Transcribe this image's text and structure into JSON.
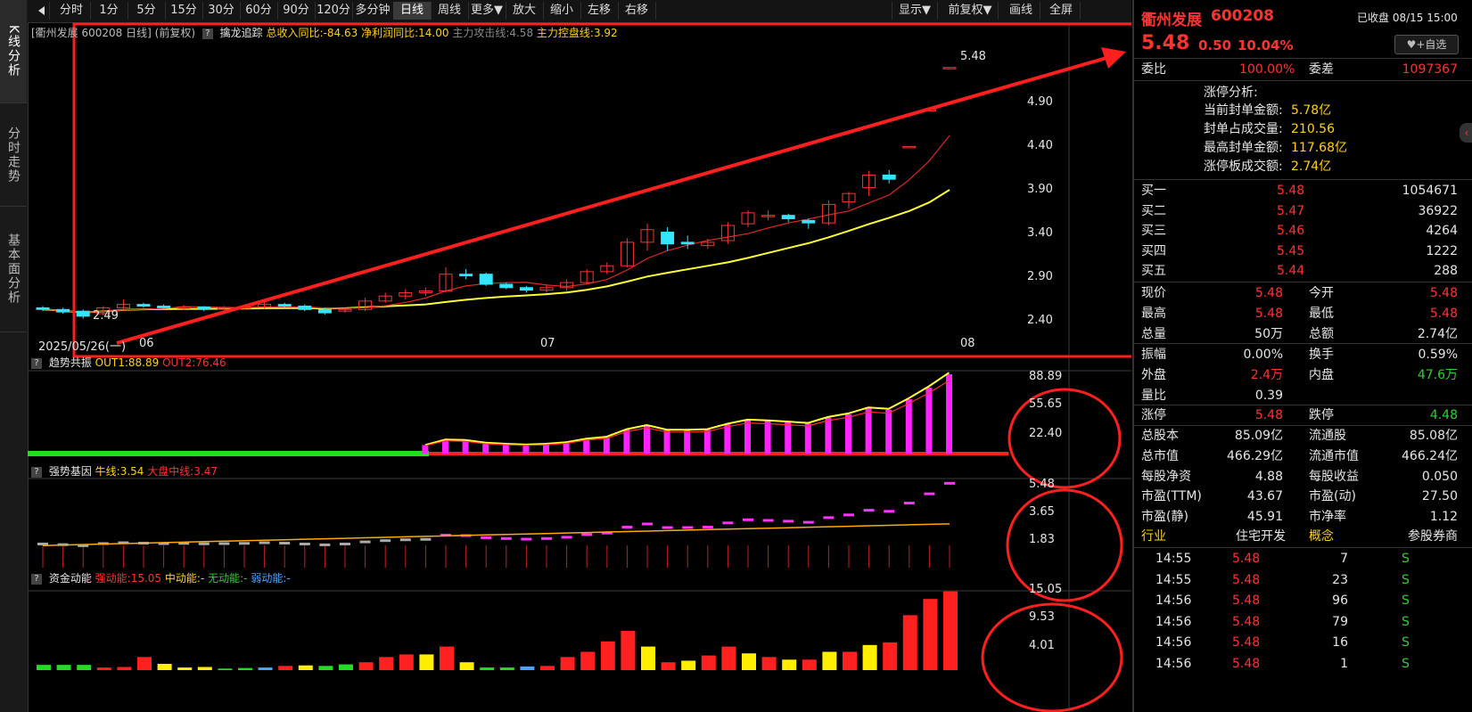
{
  "left_tabs": [
    "K线分析",
    "分时走势",
    "基本面分析"
  ],
  "toolbar": {
    "buttons": [
      "分时",
      "1分",
      "5分",
      "15分",
      "30分",
      "60分",
      "90分",
      "120分",
      "多分钟",
      "日线",
      "周线",
      "更多▼",
      "放大",
      "缩小",
      "左移",
      "右移"
    ],
    "right_buttons": [
      "显示▼",
      "前复权▼",
      "画线",
      "全屏"
    ]
  },
  "main_panel": {
    "title": "[衢州发展 600208 日线]",
    "adjust": "(前复权)",
    "indicator": "擒龙追踪",
    "rev_label": "总收入同比:-84.63",
    "profit_label": "净利润同比:14.00",
    "attack_label": "主力攻击线:4.58",
    "control_label": "主力控盘线:3.92",
    "high_label": "5.48",
    "low_label": "2.49",
    "date_label": "2025/05/26(一)",
    "months": [
      "06",
      "07",
      "08"
    ],
    "yticks": [
      "4.90",
      "4.40",
      "3.90",
      "3.40",
      "2.90",
      "2.40"
    ]
  },
  "panel2": {
    "name": "趋势共振",
    "out1": "OUT1:88.89",
    "out2": "OUT2:76.46",
    "yticks": [
      "88.89",
      "55.65",
      "22.40"
    ]
  },
  "panel3": {
    "name": "强势基因",
    "bull": "牛线:3.54",
    "mid": "大盘中线:3.47",
    "yticks": [
      "5.48",
      "3.65",
      "1.83"
    ]
  },
  "panel4": {
    "name": "资金动能",
    "strong": "强动能:15.05",
    "medium": "中动能:-",
    "none": "无动能:-",
    "weak": "弱动能:-",
    "yticks": [
      "15.05",
      "9.53",
      "4.01"
    ]
  },
  "quote": {
    "name": "衢州发展",
    "code": "600208",
    "status": "已收盘 08/15 15:00",
    "price": "5.48",
    "change": "0.50",
    "pct": "10.04%",
    "fav": "+自选",
    "webi_label": "委比",
    "webi": "100.00%",
    "wecha_label": "委差",
    "wecha": "1097367",
    "limit_title": "涨停分析:",
    "limit_rows": [
      {
        "label": "当前封单金额:",
        "value": "5.78亿"
      },
      {
        "label": "封单占成交量:",
        "value": "210.56"
      },
      {
        "label": "最高封单金额:",
        "value": "117.68亿"
      },
      {
        "label": "涨停板成交额:",
        "value": "2.74亿"
      }
    ],
    "bids": [
      {
        "label": "买一",
        "price": "5.48",
        "vol": "1054671"
      },
      {
        "label": "买二",
        "price": "5.47",
        "vol": "36922"
      },
      {
        "label": "买三",
        "price": "5.46",
        "vol": "4264"
      },
      {
        "label": "买四",
        "price": "5.45",
        "vol": "1222"
      },
      {
        "label": "买五",
        "price": "5.44",
        "vol": "288"
      }
    ],
    "stats1": [
      {
        "l1": "现价",
        "v1": "5.48",
        "c1": "red",
        "l2": "今开",
        "v2": "5.48",
        "c2": "red"
      },
      {
        "l1": "最高",
        "v1": "5.48",
        "c1": "red",
        "l2": "最低",
        "v2": "5.48",
        "c2": "red"
      },
      {
        "l1": "总量",
        "v1": "50万",
        "c1": "white",
        "l2": "总额",
        "v2": "2.74亿",
        "c2": "white"
      }
    ],
    "stats2": [
      {
        "l1": "振幅",
        "v1": "0.00%",
        "c1": "white",
        "l2": "换手",
        "v2": "0.59%",
        "c2": "white"
      },
      {
        "l1": "外盘",
        "v1": "2.4万",
        "c1": "red",
        "l2": "内盘",
        "v2": "47.6万",
        "c2": "green"
      },
      {
        "l1": "量比",
        "v1": "0.39",
        "c1": "white",
        "l2": "",
        "v2": "",
        "c2": "white"
      }
    ],
    "stats3": [
      {
        "l1": "涨停",
        "v1": "5.48",
        "c1": "red",
        "l2": "跌停",
        "v2": "4.48",
        "c2": "green"
      }
    ],
    "stats4": [
      {
        "l1": "总股本",
        "v1": "85.09亿",
        "c1": "white",
        "l2": "流通股",
        "v2": "85.08亿",
        "c2": "white"
      },
      {
        "l1": "总市值",
        "v1": "466.29亿",
        "c1": "white",
        "l2": "流通市值",
        "v2": "466.24亿",
        "c2": "white"
      },
      {
        "l1": "每股净资",
        "v1": "4.88",
        "c1": "white",
        "l2": "每股收益",
        "v2": "0.050",
        "c2": "white"
      },
      {
        "l1": "市盈(TTM)",
        "v1": "43.67",
        "c1": "white",
        "l2": "市盈(动)",
        "v2": "27.50",
        "c2": "white"
      },
      {
        "l1": "市盈(静)",
        "v1": "45.91",
        "c1": "white",
        "l2": "市净率",
        "v2": "1.12",
        "c2": "white"
      }
    ],
    "industry_label": "行业",
    "industry": "住宅开发",
    "concept_label": "概念",
    "concept": "参股券商",
    "ticks": [
      {
        "time": "14:55",
        "price": "5.48",
        "vol": "7",
        "flag": "S"
      },
      {
        "time": "14:55",
        "price": "5.48",
        "vol": "23",
        "flag": "S"
      },
      {
        "time": "14:56",
        "price": "5.48",
        "vol": "96",
        "flag": "S"
      },
      {
        "time": "14:56",
        "price": "5.48",
        "vol": "79",
        "flag": "S"
      },
      {
        "time": "14:56",
        "price": "5.48",
        "vol": "16",
        "flag": "S"
      },
      {
        "time": "14:56",
        "price": "5.48",
        "vol": "1",
        "flag": "S"
      }
    ]
  },
  "chart_data": {
    "type": "candlestick",
    "y_range": [
      2.2,
      5.7
    ],
    "candles": [
      {
        "o": 2.62,
        "c": 2.6,
        "h": 2.64,
        "l": 2.58
      },
      {
        "o": 2.6,
        "c": 2.57,
        "h": 2.62,
        "l": 2.55
      },
      {
        "o": 2.58,
        "c": 2.52,
        "h": 2.6,
        "l": 2.49
      },
      {
        "o": 2.55,
        "c": 2.62,
        "h": 2.64,
        "l": 2.53
      },
      {
        "o": 2.62,
        "c": 2.66,
        "h": 2.72,
        "l": 2.6
      },
      {
        "o": 2.66,
        "c": 2.64,
        "h": 2.68,
        "l": 2.62
      },
      {
        "o": 2.64,
        "c": 2.62,
        "h": 2.66,
        "l": 2.6
      },
      {
        "o": 2.62,
        "c": 2.63,
        "h": 2.65,
        "l": 2.6
      },
      {
        "o": 2.63,
        "c": 2.61,
        "h": 2.64,
        "l": 2.58
      },
      {
        "o": 2.61,
        "c": 2.62,
        "h": 2.64,
        "l": 2.59
      },
      {
        "o": 2.62,
        "c": 2.63,
        "h": 2.66,
        "l": 2.6
      },
      {
        "o": 2.63,
        "c": 2.66,
        "h": 2.7,
        "l": 2.61
      },
      {
        "o": 2.66,
        "c": 2.64,
        "h": 2.68,
        "l": 2.62
      },
      {
        "o": 2.64,
        "c": 2.6,
        "h": 2.66,
        "l": 2.58
      },
      {
        "o": 2.6,
        "c": 2.56,
        "h": 2.62,
        "l": 2.54
      },
      {
        "o": 2.58,
        "c": 2.6,
        "h": 2.62,
        "l": 2.56
      },
      {
        "o": 2.6,
        "c": 2.7,
        "h": 2.74,
        "l": 2.58
      },
      {
        "o": 2.7,
        "c": 2.76,
        "h": 2.8,
        "l": 2.68
      },
      {
        "o": 2.76,
        "c": 2.8,
        "h": 2.84,
        "l": 2.72
      },
      {
        "o": 2.8,
        "c": 2.82,
        "h": 2.86,
        "l": 2.76
      },
      {
        "o": 2.82,
        "c": 3.02,
        "h": 3.1,
        "l": 2.8
      },
      {
        "o": 3.02,
        "c": 3.0,
        "h": 3.08,
        "l": 2.96
      },
      {
        "o": 3.02,
        "c": 2.9,
        "h": 3.04,
        "l": 2.88
      },
      {
        "o": 2.9,
        "c": 2.86,
        "h": 2.92,
        "l": 2.84
      },
      {
        "o": 2.86,
        "c": 2.83,
        "h": 2.88,
        "l": 2.8
      },
      {
        "o": 2.83,
        "c": 2.86,
        "h": 2.9,
        "l": 2.8
      },
      {
        "o": 2.86,
        "c": 2.92,
        "h": 2.96,
        "l": 2.82
      },
      {
        "o": 2.92,
        "c": 3.05,
        "h": 3.08,
        "l": 2.9
      },
      {
        "o": 3.05,
        "c": 3.12,
        "h": 3.16,
        "l": 3.02
      },
      {
        "o": 3.12,
        "c": 3.4,
        "h": 3.45,
        "l": 3.1
      },
      {
        "o": 3.4,
        "c": 3.55,
        "h": 3.62,
        "l": 3.3
      },
      {
        "o": 3.52,
        "c": 3.38,
        "h": 3.58,
        "l": 3.3
      },
      {
        "o": 3.4,
        "c": 3.38,
        "h": 3.48,
        "l": 3.32
      },
      {
        "o": 3.36,
        "c": 3.4,
        "h": 3.44,
        "l": 3.32
      },
      {
        "o": 3.42,
        "c": 3.6,
        "h": 3.64,
        "l": 3.38
      },
      {
        "o": 3.62,
        "c": 3.75,
        "h": 3.78,
        "l": 3.58
      },
      {
        "o": 3.72,
        "c": 3.72,
        "h": 3.78,
        "l": 3.66
      },
      {
        "o": 3.72,
        "c": 3.68,
        "h": 3.74,
        "l": 3.64
      },
      {
        "o": 3.66,
        "c": 3.63,
        "h": 3.68,
        "l": 3.56
      },
      {
        "o": 3.63,
        "c": 3.85,
        "h": 3.9,
        "l": 3.6
      },
      {
        "o": 3.88,
        "c": 3.98,
        "h": 4.0,
        "l": 3.8
      },
      {
        "o": 4.05,
        "c": 4.2,
        "h": 4.25,
        "l": 3.95
      },
      {
        "o": 4.2,
        "c": 4.15,
        "h": 4.26,
        "l": 4.1
      },
      {
        "o": 4.54,
        "c": 4.54,
        "h": 4.54,
        "l": 4.54
      },
      {
        "o": 4.98,
        "c": 4.98,
        "h": 4.98,
        "l": 4.98
      },
      {
        "o": 5.48,
        "c": 5.48,
        "h": 5.48,
        "l": 5.48
      }
    ],
    "trend": [
      88.89
    ],
    "strength": [
      5.48
    ],
    "fund": [
      15.05
    ]
  }
}
